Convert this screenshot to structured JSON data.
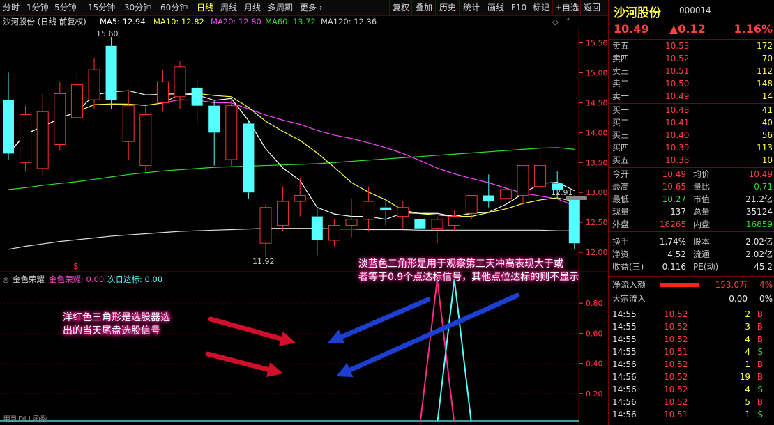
{
  "toolbar": {
    "period_tabs": [
      "分时",
      "1分钟",
      "5分钟",
      "15分钟",
      "30分钟",
      "60分钟",
      "日线",
      "周线",
      "月线",
      "多周期",
      "更多 ›"
    ],
    "active_tab": "日线",
    "tools": [
      "复权",
      "叠加",
      "历史",
      "统计",
      "画线",
      "F10",
      "标记",
      "+自选",
      "返回"
    ]
  },
  "info": {
    "title": "沙河股份 (日线 前复权)",
    "ma5": "MA5: 12.94",
    "ma10": "MA10: 12.82",
    "ma20": "MA20: 12.80",
    "ma60": "MA60: 13.72",
    "ma120": "MA120: 12.36"
  },
  "main_axis": [
    "15.50",
    "15.00",
    "14.50",
    "14.00",
    "13.50",
    "13.00",
    "12.50",
    "12.00"
  ],
  "sub_axis": [
    "0.80",
    "0.60",
    "0.40",
    "0.20"
  ],
  "annotations": {
    "high": "15.60",
    "low": "11.92",
    "last": "12.91",
    "buy_mark": "$"
  },
  "indicator": {
    "name": "金色荣耀",
    "line1": "金色荣耀: 0.00",
    "line2": "次日达标: 0.00"
  },
  "footer_text": "用到DLL函数",
  "notes": {
    "blue_1": "淡蓝色三角形是用于观察第三天冲高表现大于或",
    "blue_2": "者等于0.9个点达标信号，其他点位达标的则不显示",
    "red_1": "洋红色三角形是选股器选",
    "red_2": "出的当天尾盘选股信号"
  },
  "quote": {
    "name": "沙河股份",
    "code": "000014",
    "price": "10.49",
    "change": "▲0.12",
    "pct": "1.16%",
    "asks": [
      {
        "label": "卖五",
        "price": "10.53",
        "vol": "172"
      },
      {
        "label": "卖四",
        "price": "10.52",
        "vol": "70"
      },
      {
        "label": "卖三",
        "price": "10.51",
        "vol": "112"
      },
      {
        "label": "卖二",
        "price": "10.50",
        "vol": "148"
      },
      {
        "label": "卖一",
        "price": "10.49",
        "vol": "14"
      }
    ],
    "bids": [
      {
        "label": "买一",
        "price": "10.48",
        "vol": "41"
      },
      {
        "label": "买二",
        "price": "10.41",
        "vol": "40"
      },
      {
        "label": "买三",
        "price": "10.40",
        "vol": "56"
      },
      {
        "label": "买四",
        "price": "10.39",
        "vol": "113"
      },
      {
        "label": "买五",
        "price": "10.38",
        "vol": "10"
      }
    ],
    "stats": [
      {
        "l1": "今开",
        "v1": "10.49",
        "l2": "均价",
        "v2": "10.49"
      },
      {
        "l1": "最高",
        "v1": "10.65",
        "l2": "量比",
        "v2": "0.71"
      },
      {
        "l1": "最低",
        "v1": "10.27",
        "l2": "市值",
        "v2": "21.2亿"
      },
      {
        "l1": "现量",
        "v1": "137",
        "l2": "总量",
        "v2": "35124"
      },
      {
        "l1": "外盘",
        "v1": "18265",
        "l2": "内盘",
        "v2": "16859"
      }
    ],
    "stats2": [
      {
        "l1": "换手",
        "v1": "1.74%",
        "l2": "股本",
        "v2": "2.02亿"
      },
      {
        "l1": "净资",
        "v1": "4.52",
        "l2": "流通",
        "v2": "2.02亿"
      },
      {
        "l1": "收益(三)",
        "v1": "0.116",
        "l2": "PE(动)",
        "v2": "45.2"
      }
    ],
    "inflow": {
      "label": "净流入额",
      "value": "153.0万",
      "pct": "4%"
    },
    "block": {
      "label": "大宗流入",
      "value": "0.00",
      "pct": "0%"
    },
    "trades": [
      {
        "t": "14:55",
        "p": "10.52",
        "v": "2",
        "s": "B"
      },
      {
        "t": "14:55",
        "p": "10.52",
        "v": "3",
        "s": "B"
      },
      {
        "t": "14:55",
        "p": "10.52",
        "v": "4",
        "s": "B"
      },
      {
        "t": "14:55",
        "p": "10.51",
        "v": "4",
        "s": "S"
      },
      {
        "t": "14:56",
        "p": "10.52",
        "v": "1",
        "s": "B"
      },
      {
        "t": "14:56",
        "p": "10.52",
        "v": "19",
        "s": "B"
      },
      {
        "t": "14:56",
        "p": "10.52",
        "v": "4",
        "s": "S"
      },
      {
        "t": "14:56",
        "p": "10.52",
        "v": "5",
        "s": "B"
      },
      {
        "t": "14:56",
        "p": "10.51",
        "v": "1",
        "s": "S"
      }
    ]
  },
  "chart_data": {
    "type": "candlestick",
    "series": [
      {
        "o": 14.55,
        "c": 13.65,
        "h": 15.0,
        "l": 13.55
      },
      {
        "o": 13.5,
        "c": 14.3,
        "h": 14.45,
        "l": 13.35
      },
      {
        "o": 13.4,
        "c": 14.35,
        "h": 14.65,
        "l": 13.3
      },
      {
        "o": 13.8,
        "c": 14.65,
        "h": 14.85,
        "l": 13.7
      },
      {
        "o": 14.25,
        "c": 14.8,
        "h": 15.0,
        "l": 14.15
      },
      {
        "o": 14.55,
        "c": 15.05,
        "h": 15.25,
        "l": 14.4
      },
      {
        "o": 15.45,
        "c": 14.55,
        "h": 15.6,
        "l": 14.4
      },
      {
        "o": 13.85,
        "c": 14.45,
        "h": 14.7,
        "l": 13.55
      },
      {
        "o": 13.45,
        "c": 14.3,
        "h": 14.45,
        "l": 13.35
      },
      {
        "o": 14.5,
        "c": 14.85,
        "h": 15.05,
        "l": 14.35
      },
      {
        "o": 14.6,
        "c": 15.1,
        "h": 15.2,
        "l": 14.4
      },
      {
        "o": 14.75,
        "c": 14.45,
        "h": 14.9,
        "l": 14.15
      },
      {
        "o": 14.45,
        "c": 14.0,
        "h": 14.55,
        "l": 13.45
      },
      {
        "o": 13.55,
        "c": 14.45,
        "h": 14.55,
        "l": 13.45
      },
      {
        "o": 14.15,
        "c": 13.0,
        "h": 14.2,
        "l": 12.9
      },
      {
        "o": 12.15,
        "c": 12.75,
        "h": 12.8,
        "l": 11.92
      },
      {
        "o": 12.45,
        "c": 12.85,
        "h": 13.1,
        "l": 12.35
      },
      {
        "o": 12.85,
        "c": 12.95,
        "h": 13.25,
        "l": 12.6
      },
      {
        "o": 12.6,
        "c": 12.2,
        "h": 12.75,
        "l": 11.95
      },
      {
        "o": 12.2,
        "c": 12.45,
        "h": 12.55,
        "l": 12.1
      },
      {
        "o": 12.45,
        "c": 12.55,
        "h": 12.9,
        "l": 12.25
      },
      {
        "o": 12.55,
        "c": 12.85,
        "h": 13.1,
        "l": 12.35
      },
      {
        "o": 12.75,
        "c": 12.7,
        "h": 12.85,
        "l": 12.45
      },
      {
        "o": 12.6,
        "c": 12.75,
        "h": 12.85,
        "l": 12.4
      },
      {
        "o": 12.55,
        "c": 12.4,
        "h": 12.6,
        "l": 12.35
      },
      {
        "o": 12.4,
        "c": 12.55,
        "h": 12.6,
        "l": 12.15
      },
      {
        "o": 12.45,
        "c": 12.6,
        "h": 12.7,
        "l": 12.35
      },
      {
        "o": 12.65,
        "c": 12.95,
        "h": 12.95,
        "l": 12.55
      },
      {
        "o": 12.95,
        "c": 12.85,
        "h": 13.3,
        "l": 12.75
      },
      {
        "o": 12.9,
        "c": 13.05,
        "h": 13.25,
        "l": 12.75
      },
      {
        "o": 12.95,
        "c": 13.45,
        "h": 13.45,
        "l": 12.8
      },
      {
        "o": 13.1,
        "c": 13.45,
        "h": 13.9,
        "l": 12.9
      },
      {
        "o": 13.15,
        "c": 13.05,
        "h": 13.35,
        "l": 12.9
      },
      {
        "o": 12.91,
        "c": 12.15,
        "h": 12.95,
        "l": 12.05
      }
    ],
    "ylim": [
      11.85,
      15.75
    ],
    "indicator_ylim": [
      0,
      1.0
    ],
    "signal_pink_index": 25,
    "signal_cyan_index": 26
  }
}
